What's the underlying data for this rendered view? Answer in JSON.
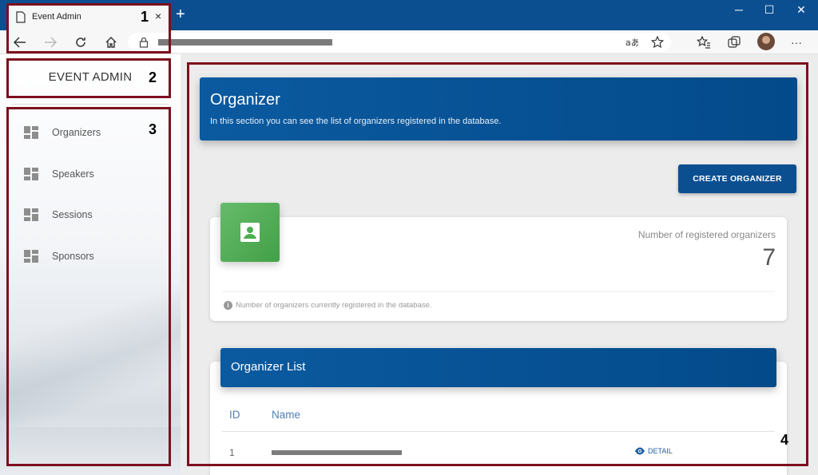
{
  "browser": {
    "tab_title": "Event Admin",
    "tab_close": "×",
    "new_tab": "+",
    "window_controls": {
      "minimize": "─",
      "maximize": "☐",
      "close": "✕"
    },
    "toolbar_icons": [
      "back-icon",
      "forward-icon",
      "refresh-icon",
      "home-icon",
      "lock-icon",
      "read-aloud-icon",
      "favorite-add-icon",
      "favorites-icon",
      "collections-icon",
      "profile-avatar",
      "more-icon"
    ],
    "more_label": "···"
  },
  "sidebar": {
    "brand": "EVENT ADMIN",
    "items": [
      {
        "label": "Organizers",
        "icon": "dashboard-icon"
      },
      {
        "label": "Speakers",
        "icon": "dashboard-icon"
      },
      {
        "label": "Sessions",
        "icon": "dashboard-icon"
      },
      {
        "label": "Sponsors",
        "icon": "dashboard-icon"
      }
    ]
  },
  "main": {
    "hero": {
      "title": "Organizer",
      "subtitle": "In this section you can see the list of organizers registered in the database."
    },
    "create_button": "CREATE ORGANIZER",
    "stat": {
      "icon": "contact-card-icon",
      "label": "Number of registered organizers",
      "value": "7",
      "footer": "Number of organizers currently registered in the database.",
      "footer_icon": "i"
    },
    "list": {
      "title": "Organizer List",
      "columns": [
        "ID",
        "Name"
      ],
      "rows": [
        {
          "id": "1",
          "detail": "DETAIL"
        }
      ]
    }
  },
  "annotations": [
    "1",
    "2",
    "3",
    "4"
  ],
  "colors": {
    "primary": "#0b4f91",
    "accent_green": "#4caf50",
    "annotation": "#7d0f1e"
  }
}
